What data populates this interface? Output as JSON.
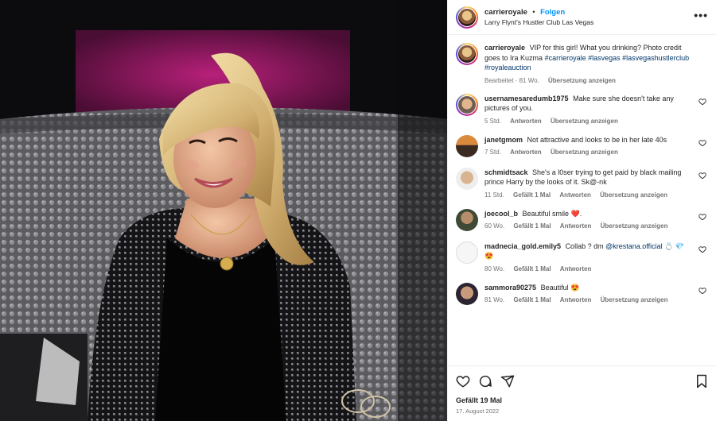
{
  "header": {
    "username": "carrieroyale",
    "separator": "•",
    "follow_label": "Folgen",
    "location": "Larry Flynt's Hustler Club Las Vegas",
    "more_icon": "more-horizontal-icon"
  },
  "caption": {
    "username": "carrieroyale",
    "text": "VIP for this girl! What you drinking? Photo credit goes to Ira Kuzma",
    "hashtags": "#carrieroyale #lasvegas #lasvegashustlerclub #royaleauction",
    "edited": "Bearbeitet · 81 Wo.",
    "translate": "Übersetzung anzeigen"
  },
  "comments": [
    {
      "username": "usernamesaredumb1975",
      "text": "Make sure she doesn't take any pictures of you.",
      "time": "5 Std.",
      "likes": "",
      "reply": "Antworten",
      "translate": "Übersetzung anzeigen"
    },
    {
      "username": "janetgmom",
      "text": "Not attractive and looks to be in her late 40s",
      "time": "7 Std.",
      "likes": "",
      "reply": "Antworten",
      "translate": "Übersetzung anzeigen"
    },
    {
      "username": "schmidtsack",
      "text": "She's a l0ser trying to get paid by black mailing prince Harry by the looks of it. Sk@-nk",
      "time": "11 Std.",
      "likes": "Gefällt 1 Mal",
      "reply": "Antworten",
      "translate": "Übersetzung anzeigen"
    },
    {
      "username": "joecool_b",
      "text": "Beautiful smile ❤️.",
      "time": "60 Wo.",
      "likes": "Gefällt 1 Mal",
      "reply": "Antworten",
      "translate": "Übersetzung anzeigen"
    },
    {
      "username": "madnecia_gold.emily5",
      "text": "Collab ? dm",
      "mention": "@krestana.official",
      "emoji": "💍 💎 😍",
      "time": "80 Wo.",
      "likes": "Gefällt 1 Mal",
      "reply": "Antworten",
      "translate": ""
    },
    {
      "username": "sammora90275",
      "text": "Beautiful 😍",
      "time": "81 Wo.",
      "likes": "Gefällt 1 Mal",
      "reply": "Antworten",
      "translate": "Übersetzung anzeigen"
    }
  ],
  "footer": {
    "likes": "Gefällt 19 Mal",
    "date": "17. August 2022",
    "icons": [
      "heart-icon",
      "comment-icon",
      "share-icon",
      "bookmark-icon"
    ]
  },
  "colors": {
    "accent": "#0095f6",
    "hashtag": "#00376b",
    "muted": "#737373",
    "border": "#efefef"
  }
}
